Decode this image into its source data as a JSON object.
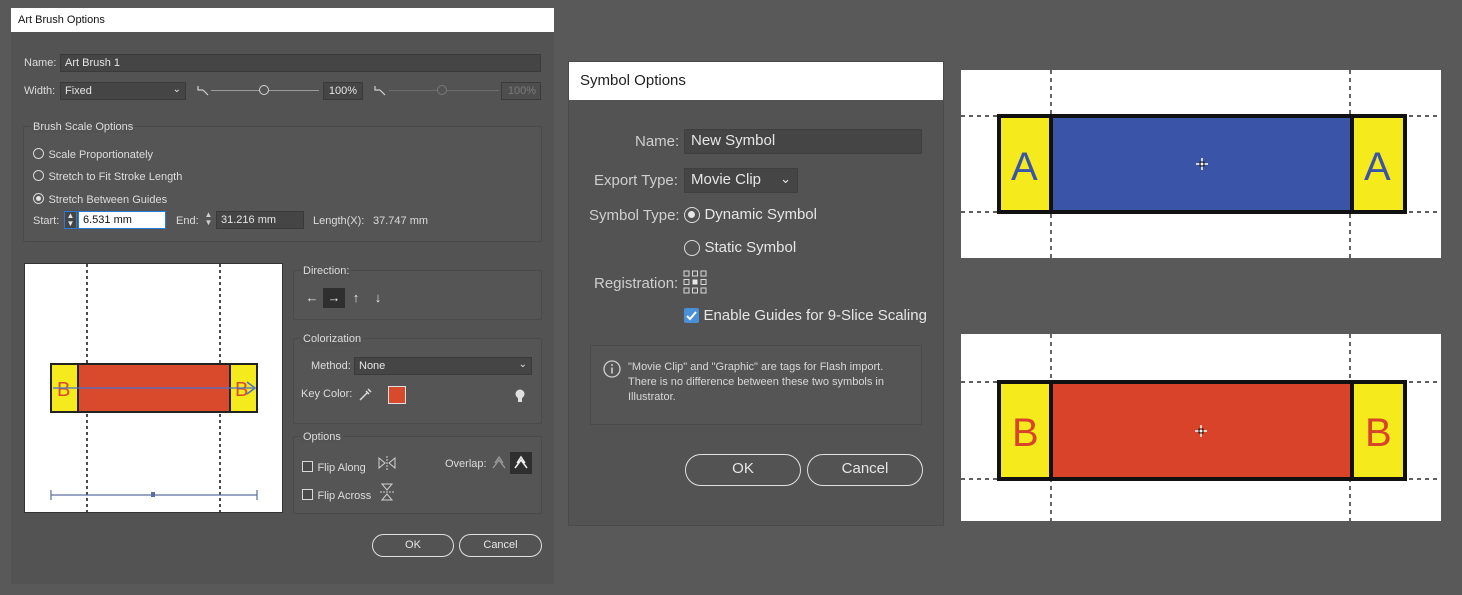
{
  "art_brush_dialog": {
    "title": "Art Brush Options",
    "name_label": "Name:",
    "name_value": "Art Brush 1",
    "width_label": "Width:",
    "width_value": "Fixed",
    "width_percent": "100%",
    "width_percent_disabled": "100%",
    "brush_scale_title": "Brush Scale Options",
    "scale_options": [
      {
        "label": "Scale Proportionately",
        "selected": false
      },
      {
        "label": "Stretch to Fit Stroke Length",
        "selected": false
      },
      {
        "label": "Stretch Between Guides",
        "selected": true
      }
    ],
    "start_label": "Start:",
    "start_value": "6.531 mm",
    "end_label": "End:",
    "end_value": "31.216 mm",
    "length_label": "Length(X):",
    "length_value": "37.747 mm",
    "preview": {
      "left_letter": "B",
      "right_letter": "B",
      "fill": "#d94a2c",
      "cap_fill": "#f4ea1c"
    },
    "direction_title": "Direction:",
    "direction_buttons": [
      "←",
      "→",
      "↑",
      "↓"
    ],
    "direction_selected": 1,
    "colorization_title": "Colorization",
    "method_label": "Method:",
    "method_value": "None",
    "key_color_label": "Key Color:",
    "key_color": "#d94a2c",
    "options_title": "Options",
    "flip_along_label": "Flip Along",
    "flip_across_label": "Flip Across",
    "overlap_label": "Overlap:",
    "ok_label": "OK",
    "cancel_label": "Cancel"
  },
  "symbol_dialog": {
    "title": "Symbol Options",
    "name_label": "Name:",
    "name_value": "New Symbol",
    "export_type_label": "Export Type:",
    "export_type_value": "Movie Clip",
    "symbol_type_label": "Symbol Type:",
    "symbol_types": [
      {
        "label": "Dynamic Symbol",
        "selected": true
      },
      {
        "label": "Static Symbol",
        "selected": false
      }
    ],
    "registration_label": "Registration:",
    "enable_guides_label": "Enable Guides for 9-Slice Scaling",
    "enable_guides_checked": true,
    "info_text": "\"Movie Clip\" and \"Graphic\" are tags for Flash import. There is no difference between these two symbols in Illustrator.",
    "ok_label": "OK",
    "cancel_label": "Cancel"
  },
  "nine_slice_previews": [
    {
      "letter": "A",
      "center_fill": "#3a55a8",
      "cap_fill": "#f4ea1c",
      "letter_color": "#3a55a8"
    },
    {
      "letter": "B",
      "center_fill": "#d9432a",
      "cap_fill": "#f4ea1c",
      "letter_color": "#d9432a"
    }
  ]
}
